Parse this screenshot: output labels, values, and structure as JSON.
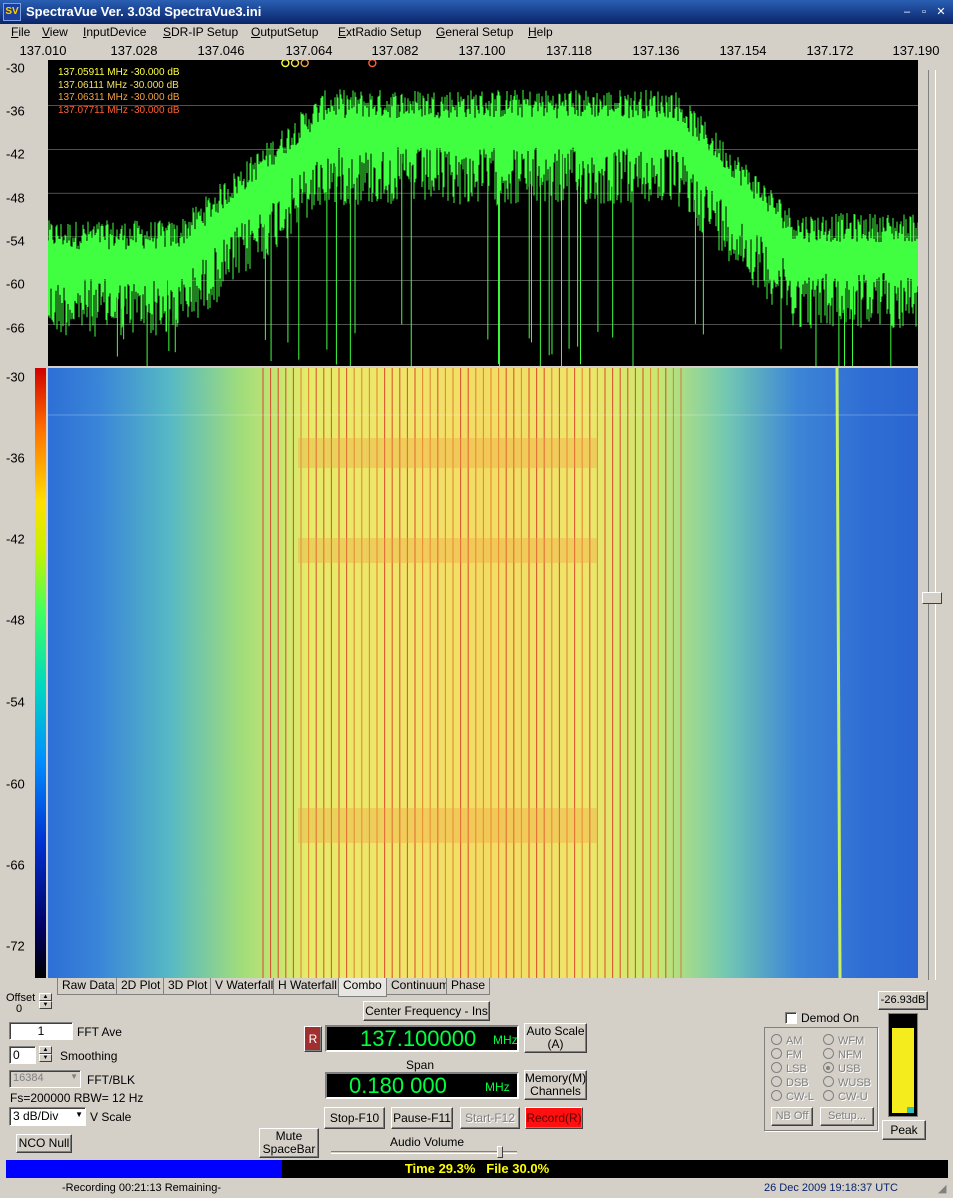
{
  "window": {
    "title": "SpectraVue Ver. 3.03d  SpectraVue3.ini",
    "icon_text": "SV",
    "minimize": "–",
    "restore": "▫",
    "close": "✕"
  },
  "menu": [
    "File",
    "View",
    "InputDevice",
    "SDR-IP Setup",
    "OutputSetup",
    "ExtRadio Setup",
    "General Setup",
    "Help"
  ],
  "freq_axis": [
    "137.010",
    "137.028",
    "137.046",
    "137.064",
    "137.082",
    "137.100",
    "137.118",
    "137.136",
    "137.154",
    "137.172",
    "137.190"
  ],
  "spectrum": {
    "db_labels": [
      "-30",
      "-36",
      "-42",
      "-48",
      "-54",
      "-60",
      "-66"
    ],
    "markers": [
      {
        "text": "137.05911 MHz  -30.000 dB",
        "color": "#ffff40",
        "freq": 137.05911
      },
      {
        "text": "137.06111 MHz  -30.000 dB",
        "color": "#f0e060",
        "freq": 137.06111
      },
      {
        "text": "137.06311 MHz  -30.000 dB",
        "color": "#f0a040",
        "freq": 137.06311
      },
      {
        "text": "137.07711 MHz  -30.000 dB",
        "color": "#ff6030",
        "freq": 137.07711
      }
    ],
    "trace_color": "#40ff40"
  },
  "waterfall": {
    "db_labels": [
      "-30",
      "-36",
      "-42",
      "-48",
      "-54",
      "-60",
      "-66",
      "-72"
    ]
  },
  "tabs": [
    "Raw Data",
    "2D Plot",
    "3D Plot",
    "V Waterfall",
    "H Waterfall",
    "Combo",
    "Continuum",
    "Phase"
  ],
  "active_tab": "Combo",
  "controls": {
    "offset_label": "Offset",
    "offset_value": "0",
    "fft_ave_value": "1",
    "fft_ave_label": "FFT Ave",
    "smoothing_value": "0",
    "smoothing_label": "Smoothing",
    "fft_blk_value": "16384",
    "fft_blk_label": "FFT/BLK",
    "fs_rbw": "Fs=200000 RBW=  12 Hz",
    "vscale_value": "3 dB/Div",
    "vscale_label": "V Scale",
    "nco_null": "NCO Null",
    "mute": "Mute\nSpaceBar",
    "center_freq_btn": "Center Frequency - Ins",
    "r_btn": "R",
    "center_freq_value": "137.100000",
    "center_freq_unit": "MHz",
    "auto_scale": "Auto Scale\n(A)",
    "span_label": "Span",
    "span_value": "0.180 000",
    "span_unit": "MHz",
    "memory": "Memory(M)\nChannels",
    "stop": "Stop-F10",
    "pause": "Pause-F11",
    "start": "Start-F12",
    "record": "Record(R)",
    "audio_volume": "Audio Volume"
  },
  "demod": {
    "demod_on": "Demod On",
    "modes": [
      "AM",
      "WFM",
      "FM",
      "NFM",
      "LSB",
      "USB",
      "DSB",
      "WUSB",
      "CW-L",
      "CW-U"
    ],
    "selected": "USB",
    "nb_off": "NB Off",
    "setup": "Setup..."
  },
  "meter": {
    "value_label": "-26.93dB",
    "peak": "Peak",
    "level": 0.88
  },
  "progress": {
    "text": "Time 29.3%   File 30.0%",
    "time_fraction": 0.293
  },
  "status": {
    "recording": "-Recording 00:21:13 Remaining-",
    "datetime": "26 Dec 2009  19:18:37 UTC"
  }
}
